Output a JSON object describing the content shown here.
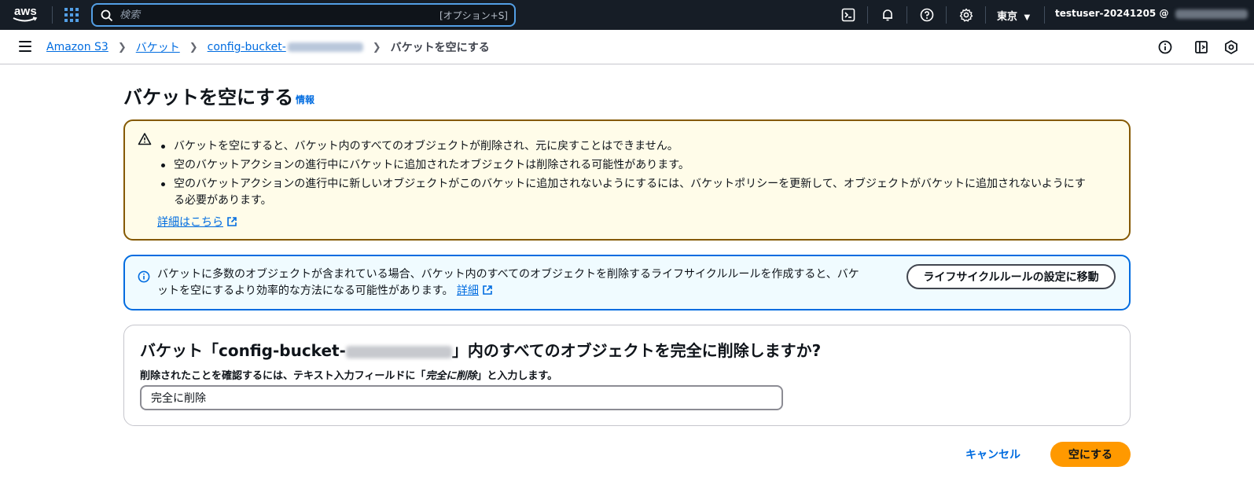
{
  "topnav": {
    "logo": "aws",
    "search_placeholder": "検索",
    "search_shortcut": "[オプション+S]",
    "region": "東京",
    "account": "testuser-20241205 @",
    "icons": [
      "services-grid-icon",
      "search-icon",
      "cloudshell-icon",
      "bell-icon",
      "help-icon",
      "gear-icon"
    ]
  },
  "breadcrumb": {
    "items": [
      "Amazon S3",
      "バケット",
      "config-bucket-"
    ],
    "current": "バケットを空にする"
  },
  "page": {
    "title": "バケットを空にする",
    "info_link": "情報"
  },
  "warning": {
    "bullets": [
      "バケットを空にすると、バケット内のすべてのオブジェクトが削除され、元に戻すことはできません。",
      "空のバケットアクションの進行中にバケットに追加されたオブジェクトは削除される可能性があります。",
      "空のバケットアクションの進行中に新しいオブジェクトがこのバケットに追加されないようにするには、バケットポリシーを更新して、オブジェクトがバケットに追加されないようにする必要があります。"
    ],
    "learn_more": "詳細はこちら"
  },
  "info": {
    "text": "バケットに多数のオブジェクトが含まれている場合、バケット内のすべてのオブジェクトを削除するライフサイクルルールを作成すると、バケットを空にするより効率的な方法になる可能性があります。",
    "detail_link": "詳細",
    "lifecycle_button": "ライフサイクルルールの設定に移動"
  },
  "confirm": {
    "heading_prefix": "バケット「config-bucket-",
    "heading_suffix": "」内のすべてのオブジェクトを完全に削除しますか?",
    "label_prefix": "削除されたことを確認するには、テキスト入力フィールドに「",
    "label_keyword": "完全に削除",
    "label_suffix": "」と入力します。",
    "input_value": "完全に削除"
  },
  "actions": {
    "cancel": "キャンセル",
    "empty": "空にする"
  },
  "colors": {
    "nav_bg": "#161d26",
    "link": "#006ce0",
    "warning_border": "#855900",
    "warning_bg": "#fffce9",
    "info_border": "#006ce0",
    "info_bg": "#f0fbff",
    "primary_button": "#ff9900"
  }
}
